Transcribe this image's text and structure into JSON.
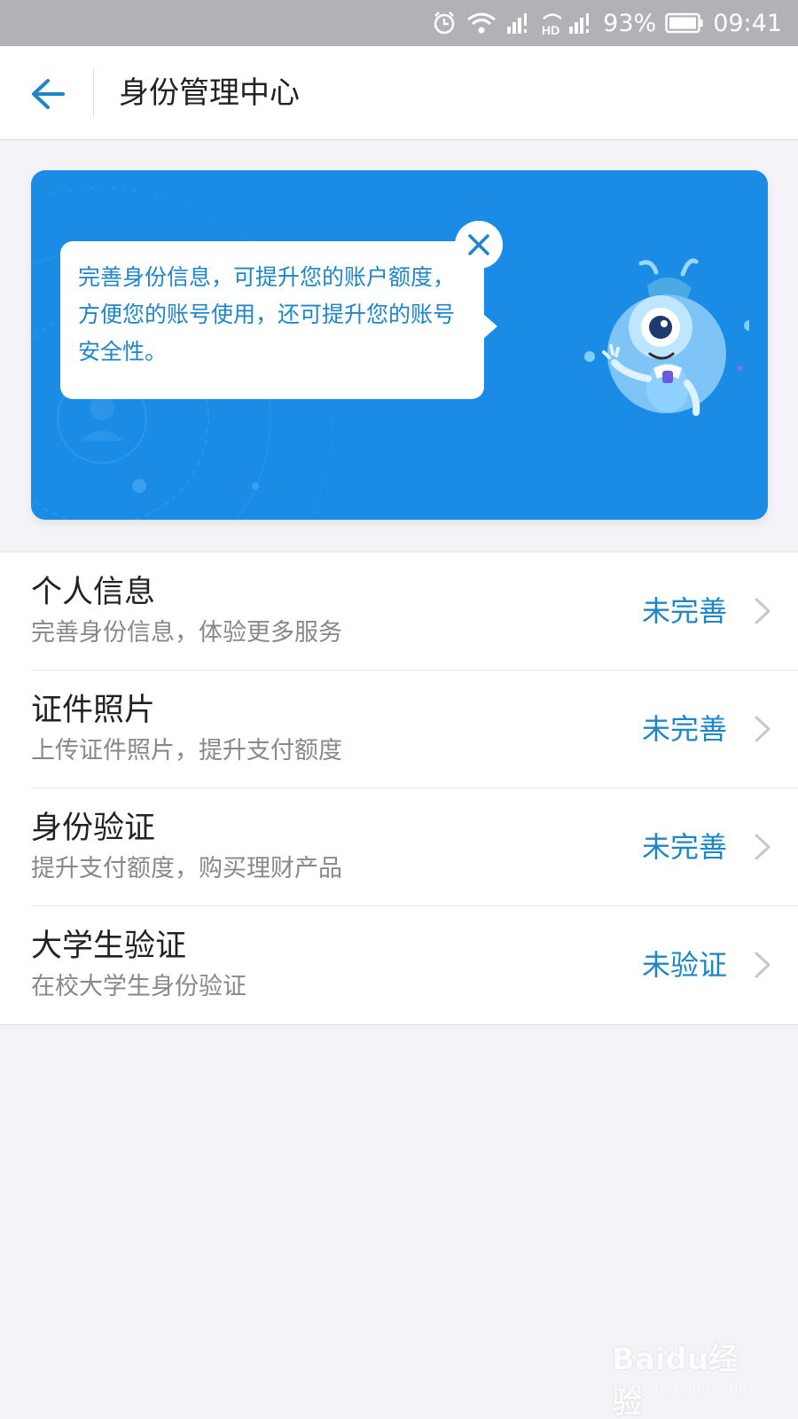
{
  "status_bar": {
    "battery_percent": "93%",
    "time": "09:41",
    "icons": [
      "alarm-icon",
      "wifi-icon",
      "signal-icon",
      "hd-signal-icon",
      "battery-icon"
    ]
  },
  "header": {
    "back_icon": "back-arrow-icon",
    "title": "身份管理中心"
  },
  "banner": {
    "message": "完善身份信息，可提升您的账户额度，方便您的账号使用，还可提升您的账号安全性。",
    "close_icon": "close-icon",
    "background_color": "#1a8ce6"
  },
  "list": {
    "items": [
      {
        "title": "个人信息",
        "subtitle": "完善身份信息，体验更多服务",
        "status": "未完善"
      },
      {
        "title": "证件照片",
        "subtitle": "上传证件照片，提升支付额度",
        "status": "未完善"
      },
      {
        "title": "身份验证",
        "subtitle": "提升支付额度，购买理财产品",
        "status": "未完善"
      },
      {
        "title": "大学生验证",
        "subtitle": "在校大学生身份验证",
        "status": "未验证"
      }
    ],
    "status_color": "#1e86c8"
  },
  "watermark": {
    "brand": "Baidu经验",
    "url": "jingyan.baidu.com"
  }
}
